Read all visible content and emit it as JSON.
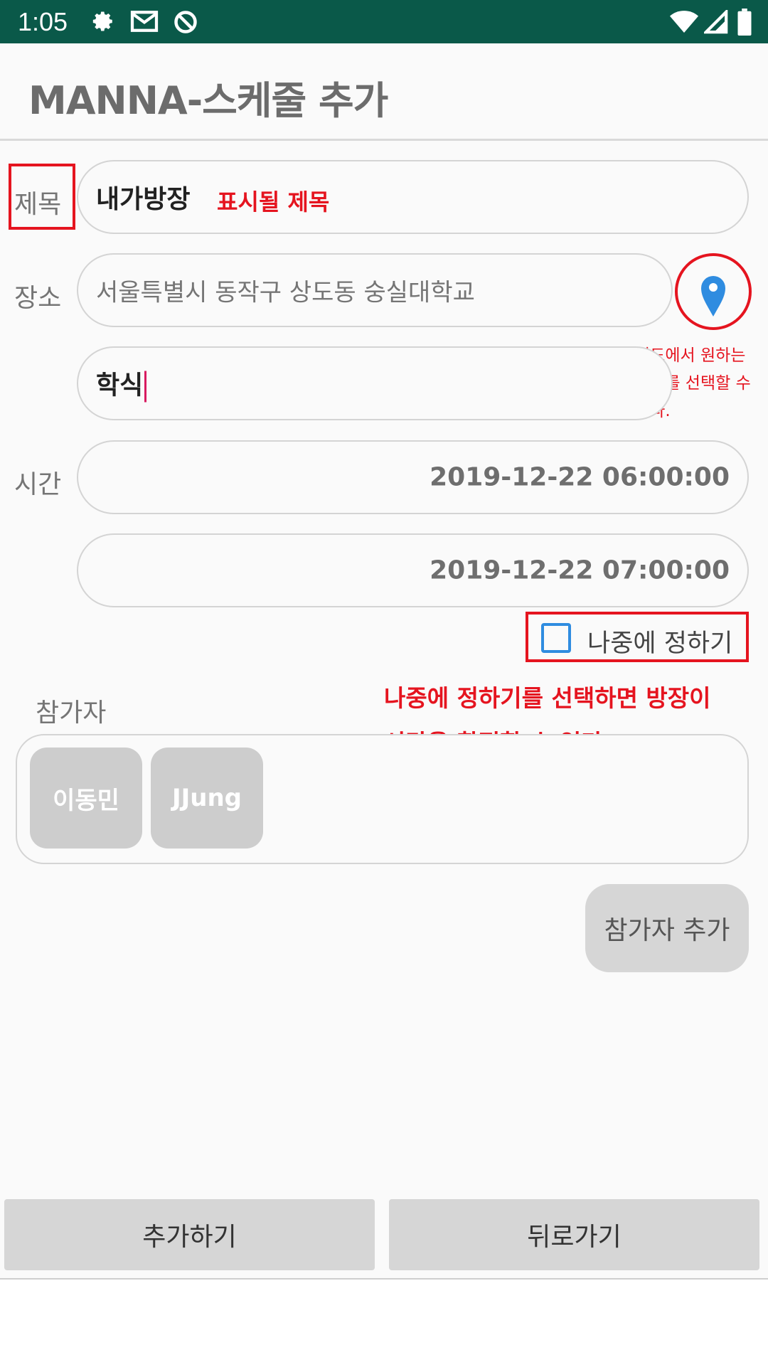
{
  "status_bar": {
    "time": "1:05",
    "left_icons": [
      "gear-icon",
      "mail-icon",
      "sync-off-icon"
    ],
    "right_icons": [
      "wifi-icon",
      "signal-icon",
      "battery-icon"
    ]
  },
  "app_bar": {
    "title": "MANNA-스케줄 추가"
  },
  "form": {
    "title_label": "제목",
    "title_value": "내가방장",
    "place_label": "장소",
    "place_value": "서울특별시 동작구 상도동 숭실대학교",
    "place_detail_value": "학식",
    "time_label": "시간",
    "start_time": "2019-12-22 06:00:00",
    "end_time": "2019-12-22 07:00:00",
    "decide_later_label": "나중에 정하기",
    "participants_label": "참가자",
    "participants": [
      "이동민",
      "JJung"
    ],
    "add_participant_label": "참가자 추가"
  },
  "annotations": {
    "title_note": "표시될 제목",
    "map_note_lines": [
      "지도에서 원하는",
      "위치를 선택할 수",
      "있다."
    ],
    "decide_note_lines": [
      "나중에 정하기를 선택하면 방장이",
      "시간을 확정할 수 있다."
    ]
  },
  "bottom_buttons": {
    "add": "추가하기",
    "back": "뒤로가기"
  },
  "colors": {
    "status_bar": "#0a5949",
    "annotation_red": "#e5141f",
    "pin_blue": "#2f8ce0",
    "cursor_pink": "#d81b60"
  }
}
